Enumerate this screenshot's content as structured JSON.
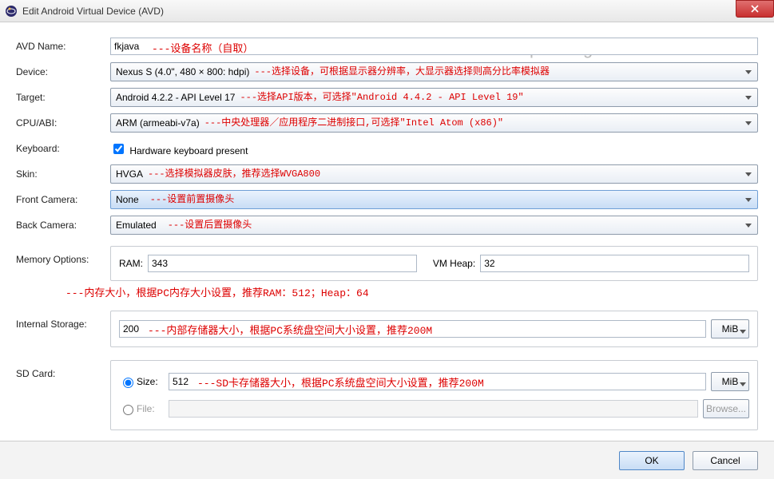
{
  "window": {
    "title": "Edit Android Virtual Device (AVD)"
  },
  "watermark": "http://blog.csdn.net/CXHPLY",
  "labels": {
    "avd_name": "AVD Name:",
    "device": "Device:",
    "target": "Target:",
    "cpu_abi": "CPU/ABI:",
    "keyboard": "Keyboard:",
    "skin": "Skin:",
    "front_camera": "Front Camera:",
    "back_camera": "Back Camera:",
    "memory_options": "Memory Options:",
    "internal_storage": "Internal Storage:",
    "sd_card": "SD Card:"
  },
  "fields": {
    "avd_name": "fkjava",
    "device": "Nexus S (4.0\", 480 × 800: hdpi)",
    "target": "Android 4.2.2 - API Level 17",
    "cpu_abi": "ARM (armeabi-v7a)",
    "keyboard_cb_label": " Hardware keyboard present",
    "skin": "HVGA",
    "front_camera": "None",
    "back_camera": "Emulated",
    "ram_label": "RAM:",
    "ram": "343",
    "vmheap_label": "VM Heap:",
    "vmheap": "32",
    "internal_storage": "200",
    "internal_unit": "MiB",
    "sd_size_label": "Size:",
    "sd_size": "512",
    "sd_unit": "MiB",
    "sd_file_label": "File:",
    "sd_file": "",
    "browse": "Browse..."
  },
  "annot": {
    "avd_name": "---设备名称（自取）",
    "device": "---选择设备，可根据显示器分辨率，大显示器选择则高分比率模拟器",
    "target": "---选择API版本，可选择\"Android 4.4.2 - API Level 19\"",
    "cpu_abi": " ---中央处理器／应用程序二进制接口,可选择\"Intel Atom (x86)\"",
    "skin": "---选择模拟器皮肤，推荐选择WVGA800",
    "front_camera": "---设置前置摄像头",
    "back_camera": "---设置后置摄像头",
    "memory": "---内存大小，根据PC内存大小设置，推荐RAM：512；Heap：64",
    "internal": "---内部存储器大小，根据PC系统盘空间大小设置，推荐200M",
    "sd": "---SD卡存储器大小，根据PC系统盘空间大小设置，推荐200M"
  },
  "buttons": {
    "ok": "OK",
    "cancel": "Cancel"
  }
}
